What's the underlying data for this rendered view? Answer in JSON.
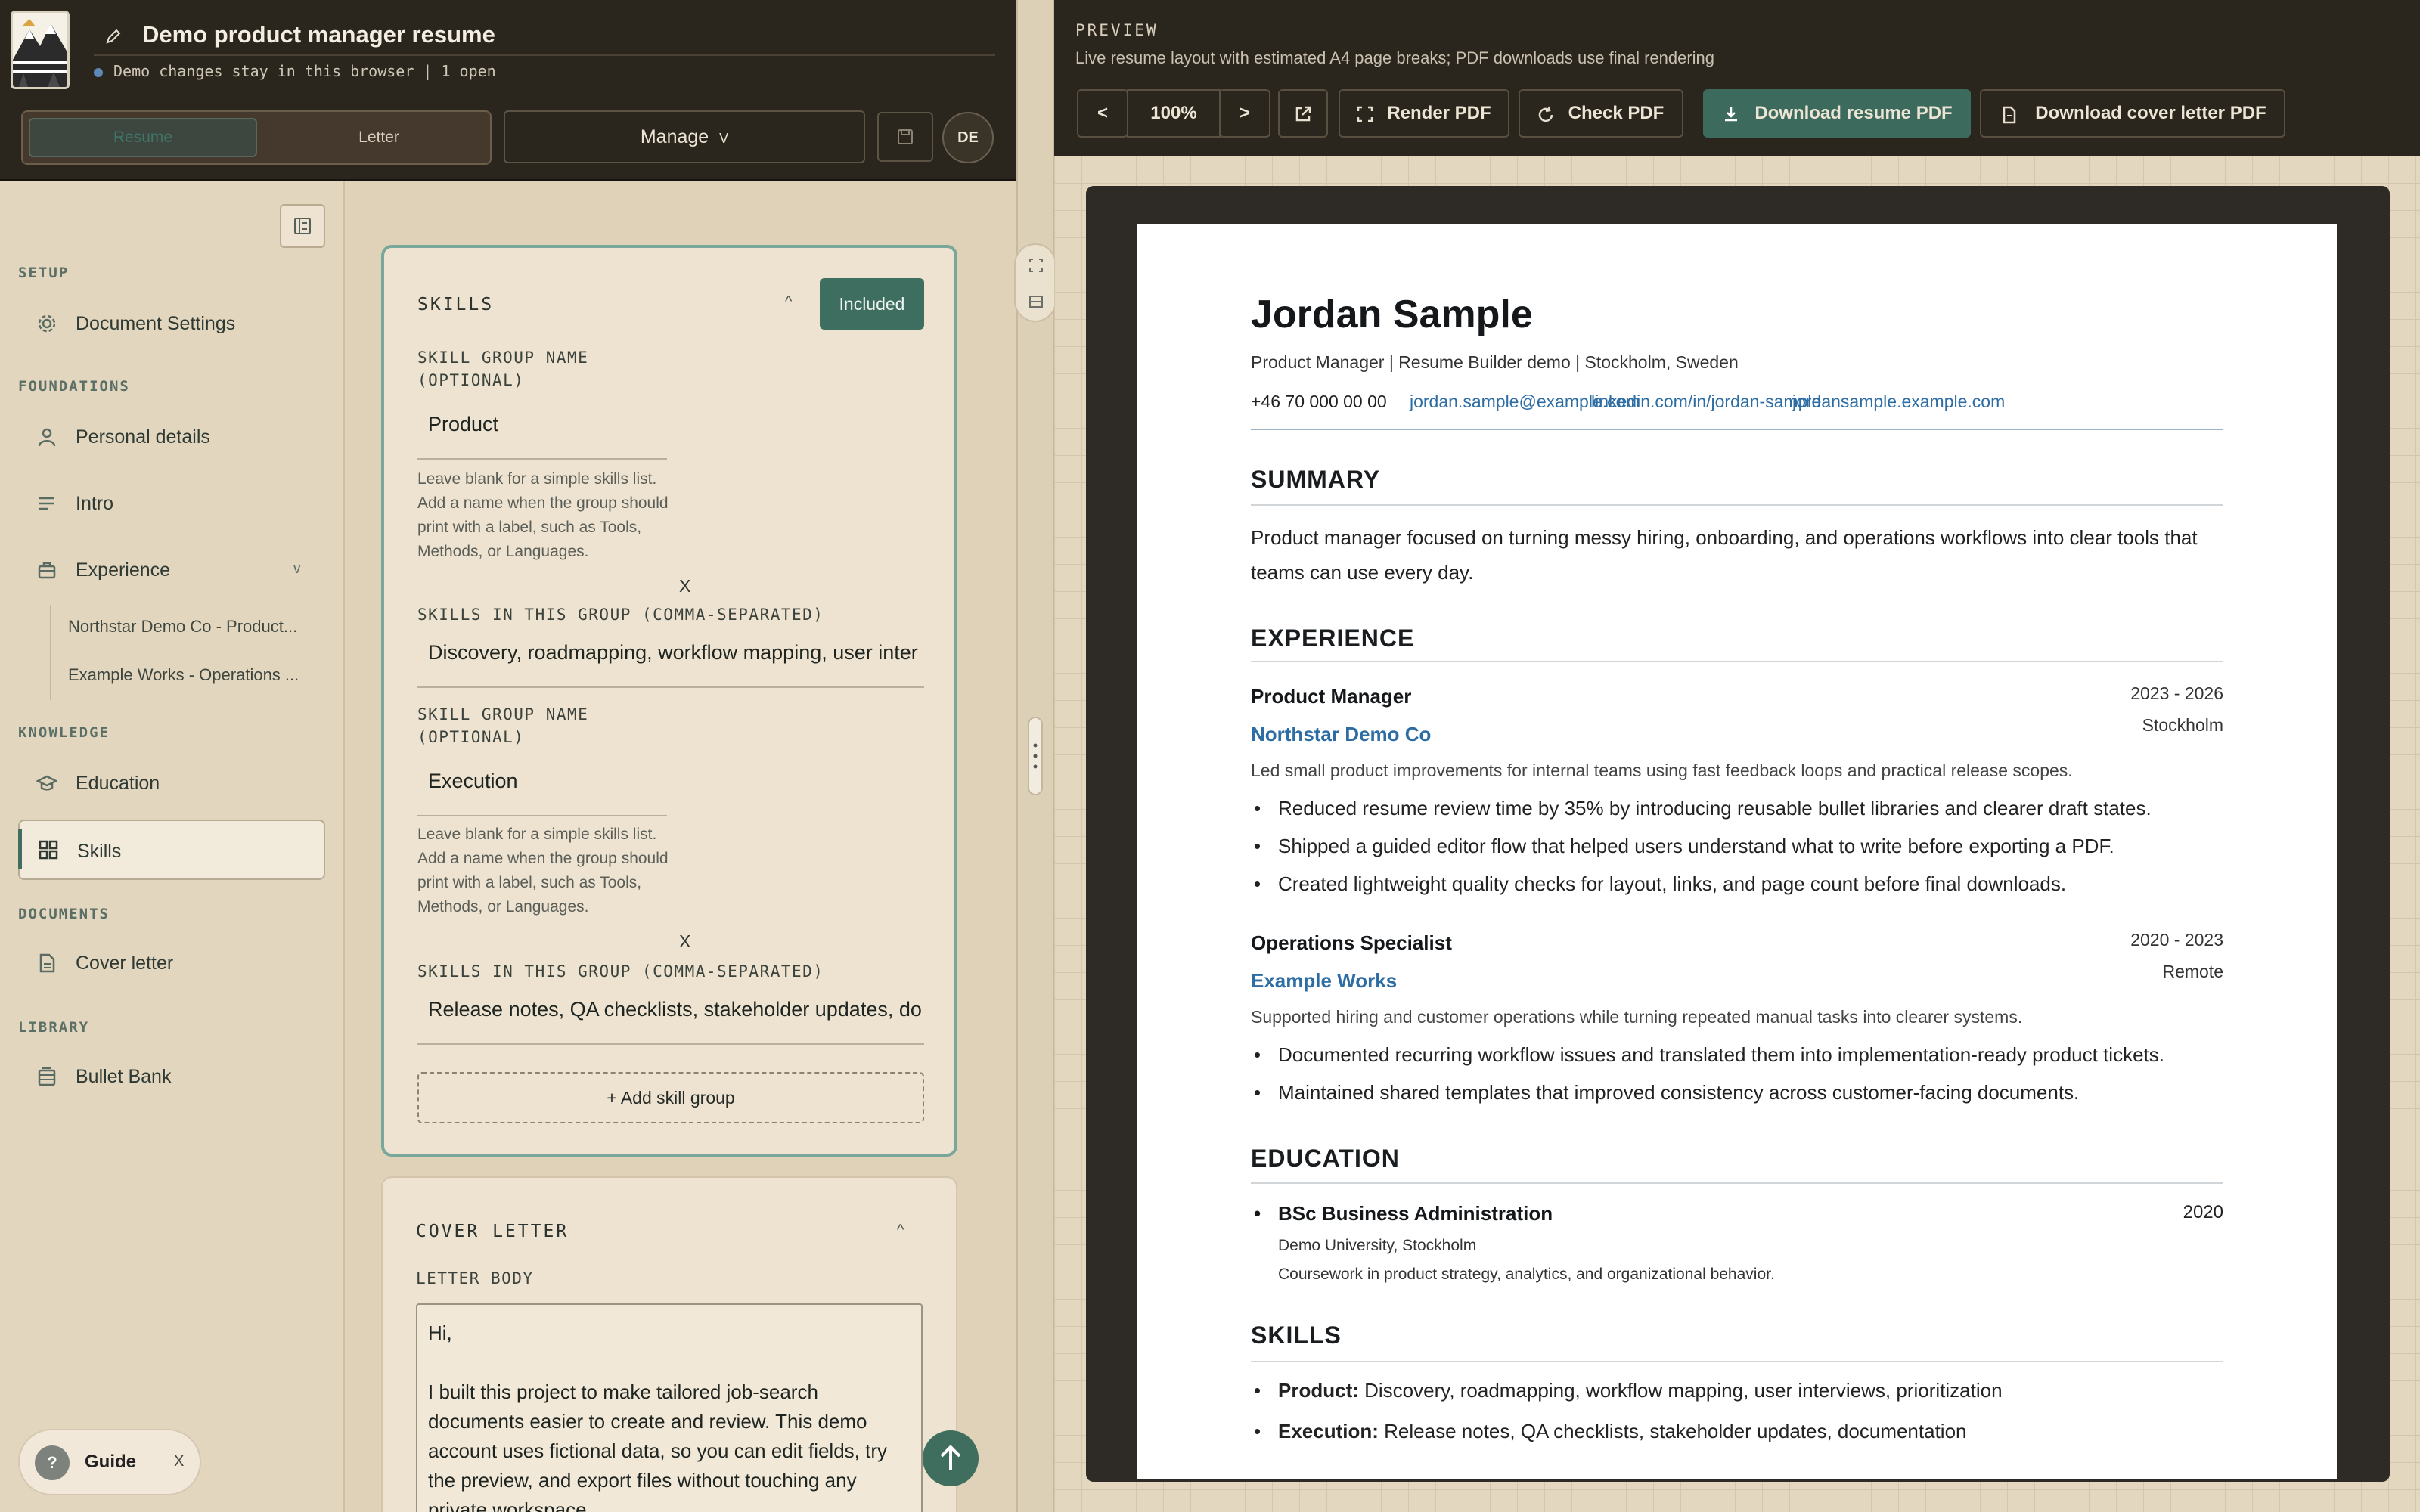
{
  "app": {
    "document_title": "Demo product manager resume",
    "status": "Demo changes stay in this browser | 1 open",
    "modes": [
      "Resume",
      "Letter"
    ],
    "manage_label": "Manage",
    "manage_chevron": "V",
    "user_initials": "DE"
  },
  "sidebar": {
    "sections": {
      "setup": "SETUP",
      "foundations": "FOUNDATIONS",
      "knowledge": "KNOWLEDGE",
      "documents": "DOCUMENTS",
      "library": "LIBRARY"
    },
    "items": {
      "document_settings": "Document Settings",
      "personal_details": "Personal details",
      "intro": "Intro",
      "experience": "Experience",
      "experience_chevron": "v",
      "experience_subs": [
        "Northstar Demo Co - Product...",
        "Example Works - Operations ..."
      ],
      "education": "Education",
      "skills": "Skills",
      "cover_letter": "Cover letter",
      "bullet_bank": "Bullet Bank"
    },
    "active": "Skills"
  },
  "skills_card": {
    "title": "SKILLS",
    "caret": "^",
    "included_label": "Included",
    "group_name_label_1": "SKILL GROUP NAME",
    "group_name_label_2": "(OPTIONAL)",
    "help_text": "Leave blank for a simple skills list. Add a name when the group should print with a label, such as Tools, Methods, or Languages.",
    "skills_label": "SKILLS IN THIS GROUP (COMMA-SEPARATED)",
    "remove_label": "X",
    "groups": [
      {
        "name": "Product",
        "skills": "Discovery, roadmapping, workflow mapping, user inter"
      },
      {
        "name": "Execution",
        "skills": "Release notes, QA checklists, stakeholder updates, do"
      }
    ],
    "add_label": "+ Add skill group"
  },
  "cover_letter_card": {
    "title": "COVER LETTER",
    "caret": "^",
    "body_label": "LETTER BODY",
    "body_greeting": "Hi,",
    "body_text": "I built this project to make tailored job-search documents easier to create and review. This demo account uses fictional data, so you can edit fields, try the preview, and export files without touching any private workspace."
  },
  "guide": {
    "q": "?",
    "label": "Guide",
    "close": "X"
  },
  "preview": {
    "title": "PREVIEW",
    "subtitle": "Live resume layout with estimated A4 page breaks; PDF downloads use final rendering",
    "prev": "<",
    "zoom": "100%",
    "next": ">",
    "render_pdf": "Render PDF",
    "check_pdf": "Check PDF",
    "download_resume": "Download resume PDF",
    "download_letter": "Download cover letter PDF"
  },
  "resume": {
    "name": "Jordan Sample",
    "tagline": "Product Manager | Resume Builder demo | Stockholm, Sweden",
    "phone": "+46 70 000 00 00",
    "email": "jordan.sample@example.com",
    "linkedin": "linkedin.com/in/jordan-sample",
    "website": "jordansample.example.com",
    "summary_heading": "SUMMARY",
    "summary": "Product manager focused on turning messy hiring, onboarding, and operations workflows into clear tools that teams can use every day.",
    "experience_heading": "EXPERIENCE",
    "jobs": [
      {
        "role": "Product Manager",
        "dates": "2023 - 2026",
        "company": "Northstar Demo Co",
        "location": "Stockholm",
        "desc": "Led small product improvements for internal teams using fast feedback loops and practical release scopes.",
        "bullets": [
          "Reduced resume review time by 35% by introducing reusable bullet libraries and clearer draft states.",
          "Shipped a guided editor flow that helped users understand what to write before exporting a PDF.",
          "Created lightweight quality checks for layout, links, and page count before final downloads."
        ]
      },
      {
        "role": "Operations Specialist",
        "dates": "2020 - 2023",
        "company": "Example Works",
        "location": "Remote",
        "desc": "Supported hiring and customer operations while turning repeated manual tasks into clearer systems.",
        "bullets": [
          "Documented recurring workflow issues and translated them into implementation-ready product tickets.",
          "Maintained shared templates that improved consistency across customer-facing documents."
        ]
      }
    ],
    "education_heading": "EDUCATION",
    "degree": "BSc Business Administration",
    "degree_year": "2020",
    "school": "Demo University, Stockholm",
    "coursework": "Coursework in product strategy, analytics, and organizational behavior.",
    "skills_heading": "SKILLS",
    "skills": [
      {
        "label": "Product:",
        "text": "Discovery, roadmapping, workflow mapping, user interviews, prioritization"
      },
      {
        "label": "Execution:",
        "text": "Release notes, QA checklists, stakeholder updates, documentation"
      }
    ]
  },
  "colors": {
    "accent_green": "#3e6e60",
    "link_blue": "#2e6da4",
    "header_dark": "#2b261d",
    "sidebar_bg": "#e3d6bf"
  }
}
